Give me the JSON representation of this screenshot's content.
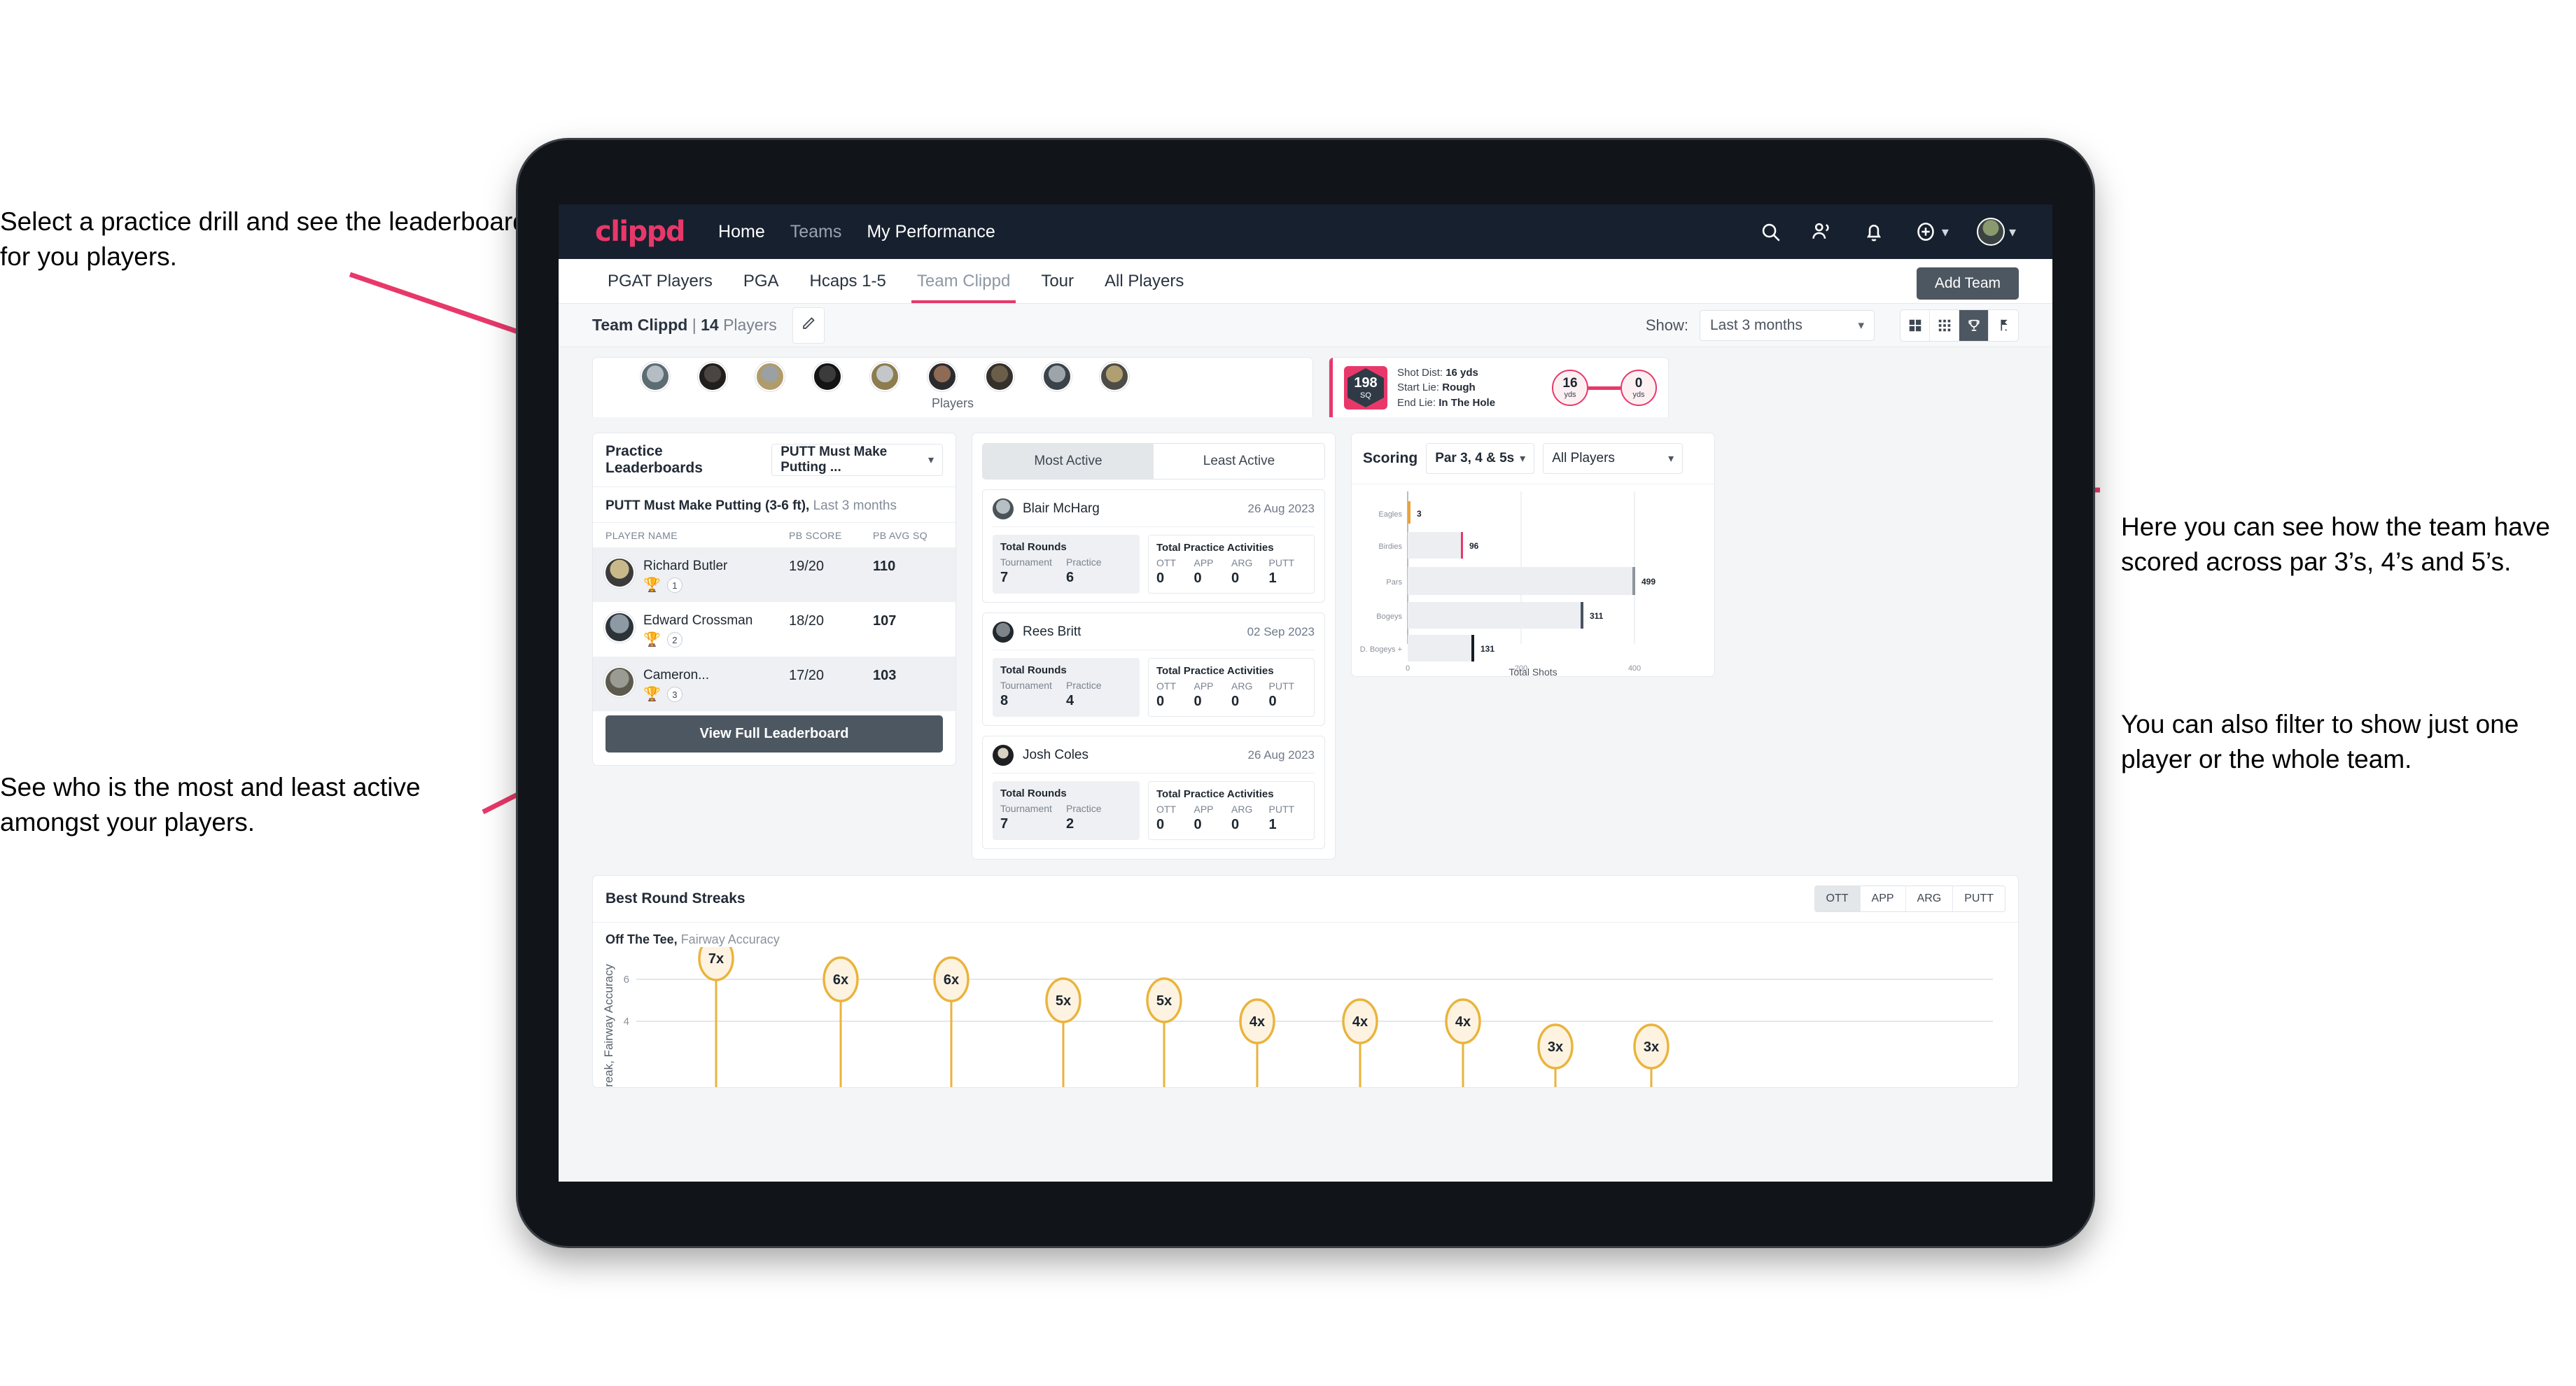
{
  "annotations": {
    "a1": "Select a practice drill and see the leaderboard for you players.",
    "a2": "See who is the most and least active amongst your players.",
    "a3": "Here you can see how the team have scored across par 3’s, 4’s and 5’s.",
    "a4": "You can also filter to show just one player or the whole team.",
    "accent": "#e8386a"
  },
  "navbar": {
    "logo": "clippd",
    "links": [
      {
        "label": "Home",
        "active": true
      },
      {
        "label": "Teams",
        "active": false
      },
      {
        "label": "My Performance",
        "active": true
      }
    ],
    "icons": [
      "search-icon",
      "people-icon",
      "bell-icon",
      "plus-circle-icon",
      "avatar"
    ]
  },
  "subnav": {
    "tabs": [
      {
        "label": "PGAT Players",
        "active": false
      },
      {
        "label": "PGA",
        "active": false
      },
      {
        "label": "Hcaps 1-5",
        "active": false
      },
      {
        "label": "Team Clippd",
        "active": true
      },
      {
        "label": "Tour",
        "active": false
      },
      {
        "label": "All Players",
        "active": false
      }
    ],
    "add_team_label": "Add Team"
  },
  "teambar": {
    "team_name": "Team Clippd",
    "separator": "|",
    "player_count": "14",
    "players_word": "Players",
    "edit_icon": "pencil-icon",
    "show_label": "Show:",
    "show_value": "Last 3 months",
    "view_toggles": [
      {
        "icon": "grid-large-icon",
        "active": false
      },
      {
        "icon": "grid-small-icon",
        "active": false
      },
      {
        "icon": "trophy-icon",
        "active": true
      },
      {
        "icon": "flag-icon",
        "active": false
      }
    ]
  },
  "players_card": {
    "label": "Players",
    "avatar_count": 9
  },
  "shot_card": {
    "badge_number": "198",
    "badge_unit": "SQ",
    "lines": [
      {
        "k": "Shot Dist:",
        "v": "16 yds"
      },
      {
        "k": "Start Lie:",
        "v": "Rough"
      },
      {
        "k": "End Lie:",
        "v": "In The Hole"
      }
    ],
    "start_value": "16",
    "start_unit": "yds",
    "end_value": "0",
    "end_unit": "yds"
  },
  "leaderboard": {
    "title": "Practice Leaderboards",
    "drill_select": "PUTT Must Make Putting ...",
    "subtitle_bold": "PUTT Must Make Putting (3-6 ft),",
    "subtitle_muted": " Last 3 months",
    "columns": [
      "PLAYER NAME",
      "PB SCORE",
      "PB AVG SQ"
    ],
    "rows": [
      {
        "name": "Richard Butler",
        "rank": "1",
        "trophy": "gold",
        "score": "19/20",
        "avg_sq": "110"
      },
      {
        "name": "Edward Crossman",
        "rank": "2",
        "trophy": "silver",
        "score": "18/20",
        "avg_sq": "107"
      },
      {
        "name": "Cameron...",
        "rank": "3",
        "trophy": "bronze",
        "score": "17/20",
        "avg_sq": "103"
      }
    ],
    "button_label": "View Full Leaderboard"
  },
  "activity": {
    "tabs": [
      {
        "label": "Most Active",
        "active": true
      },
      {
        "label": "Least Active",
        "active": false
      }
    ],
    "rounds_header": "Total Rounds",
    "rounds_cols": [
      "Tournament",
      "Practice"
    ],
    "acts_header": "Total Practice Activities",
    "acts_cols": [
      "OTT",
      "APP",
      "ARG",
      "PUTT"
    ],
    "cards": [
      {
        "name": "Blair McHarg",
        "date": "26 Aug 2023",
        "tournament": "7",
        "practice": "6",
        "ott": "0",
        "app": "0",
        "arg": "0",
        "putt": "1"
      },
      {
        "name": "Rees Britt",
        "date": "02 Sep 2023",
        "tournament": "8",
        "practice": "4",
        "ott": "0",
        "app": "0",
        "arg": "0",
        "putt": "0"
      },
      {
        "name": "Josh Coles",
        "date": "26 Aug 2023",
        "tournament": "7",
        "practice": "2",
        "ott": "0",
        "app": "0",
        "arg": "0",
        "putt": "1"
      }
    ]
  },
  "scoring": {
    "title": "Scoring",
    "par_select": "Par 3, 4 & 5s",
    "player_select": "All Players"
  },
  "streaks": {
    "title": "Best Round Streaks",
    "tabs": [
      {
        "label": "OTT",
        "active": true
      },
      {
        "label": "APP",
        "active": false
      },
      {
        "label": "ARG",
        "active": false
      },
      {
        "label": "PUTT",
        "active": false
      }
    ],
    "subtitle_bold": "Off The Tee,",
    "subtitle_muted": " Fairway Accuracy"
  },
  "chart_data": [
    {
      "type": "bar",
      "orientation": "horizontal",
      "title": "Scoring",
      "categories": [
        "Eagles",
        "Birdies",
        "Pars",
        "Bogeys",
        "D. Bogeys +"
      ],
      "values": [
        3,
        96,
        499,
        311,
        131
      ],
      "bar_end_colors": [
        "#e8a33c",
        "#e8386a",
        "#8e949c",
        "#4a535f",
        "#151c24"
      ],
      "xlabel": "Total Shots",
      "ylabel": "",
      "xlim": [
        0,
        520
      ],
      "xticks": [
        0,
        200,
        400
      ],
      "grid": true,
      "legend": "none"
    },
    {
      "type": "scatter",
      "title": "Best Round Streaks",
      "subtitle": "Off The Tee, Fairway Accuracy",
      "ylabel": "Streak, Fairway Accuracy",
      "values": [
        7,
        6,
        6,
        5,
        5,
        4,
        4,
        4,
        3,
        3
      ],
      "labels": [
        "7x",
        "6x",
        "6x",
        "5x",
        "5x",
        "4x",
        "4x",
        "4x",
        "3x",
        "3x"
      ],
      "yticks": [
        4,
        6
      ],
      "ylim": [
        0,
        8
      ],
      "marker_color": "#eab33c",
      "grid": true
    }
  ]
}
